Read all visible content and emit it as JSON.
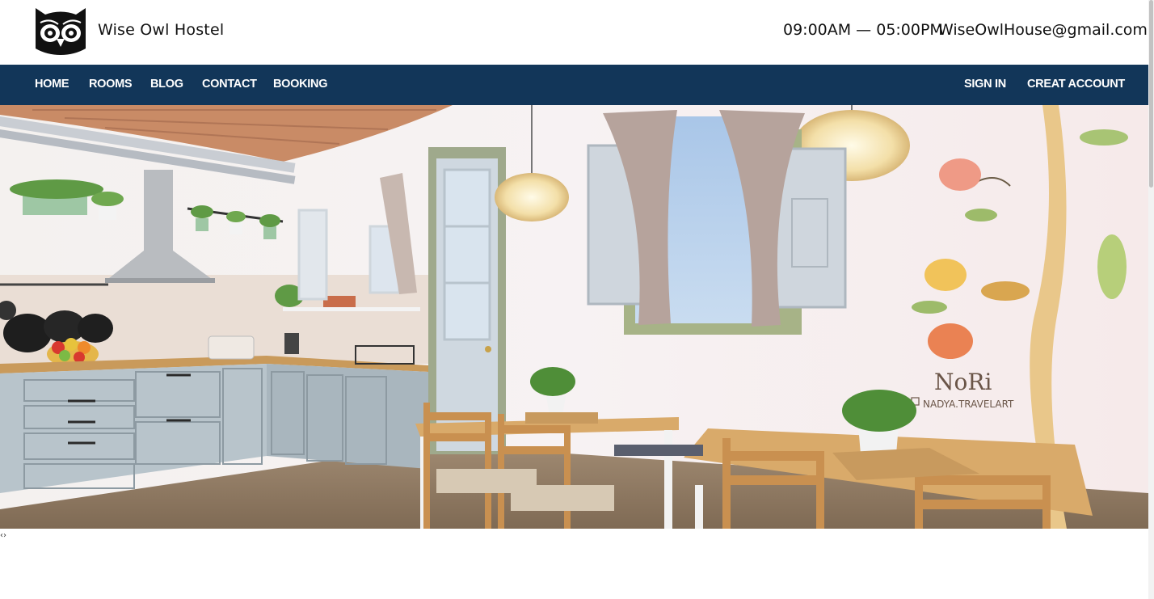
{
  "header": {
    "brand_name": "Wise Owl Hostel",
    "hours": "09:00AM — 05:00PM",
    "email": "WiseOwlHouse@gmail.com",
    "logo_icon": "owl-logo-icon"
  },
  "nav": {
    "left_items": [
      "HOME",
      "ROOMS",
      "BLOG",
      "CONTACT",
      "BOOKING"
    ],
    "right_items": [
      "SIGN IN",
      "CREAT ACCOUNT"
    ]
  },
  "hero": {
    "mural_signature": "NoRi",
    "mural_credit": "NADYA.TRAVELART"
  },
  "carousel": {
    "prev_label": "‹",
    "next_label": "›"
  },
  "colors": {
    "nav_background": "#123659",
    "nav_text": "#ffffff",
    "header_text": "#111111"
  }
}
